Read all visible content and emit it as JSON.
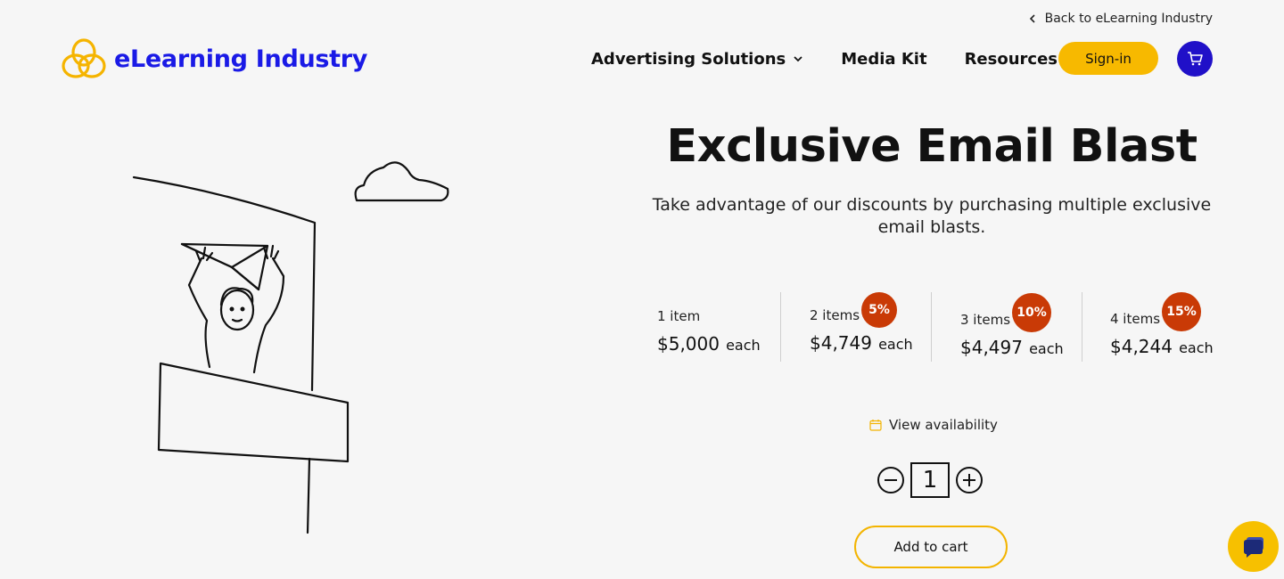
{
  "header": {
    "back_link": "Back to eLearning Industry",
    "logo_text": "eLearning Industry",
    "nav": [
      {
        "label": "Advertising Solutions",
        "has_dropdown": true
      },
      {
        "label": "Media Kit",
        "has_dropdown": false
      },
      {
        "label": "Resources",
        "has_dropdown": true
      }
    ],
    "signin_label": "Sign-in",
    "cart_icon": "cart-icon"
  },
  "product": {
    "title": "Exclusive Email Blast",
    "subtitle": "Take advantage of our discounts by purchasing multiple exclusive email blasts.",
    "tiers": [
      {
        "qty": "1 item",
        "price": "$5,000",
        "each": "each",
        "badge": null
      },
      {
        "qty": "2 items",
        "price": "$4,749",
        "each": "each",
        "badge": "5%"
      },
      {
        "qty": "3 items",
        "price": "$4,497",
        "each": "each",
        "badge": "10%"
      },
      {
        "qty": "4 items",
        "price": "$4,244",
        "each": "each",
        "badge": "15%"
      }
    ],
    "availability_label": "View availability",
    "quantity": "1",
    "add_to_cart_label": "Add to cart"
  },
  "colors": {
    "brand_blue": "#1a1ae6",
    "accent_yellow": "#f7b900",
    "badge_orange": "#c93a06",
    "cart_blue": "#2010c8"
  }
}
